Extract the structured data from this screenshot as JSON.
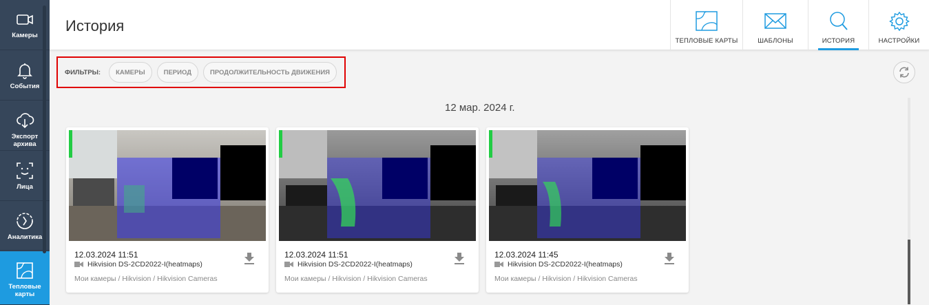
{
  "sidebar": {
    "items": [
      {
        "label": "Камеры",
        "icon": "camera-icon"
      },
      {
        "label": "События",
        "icon": "bell-icon"
      },
      {
        "label": "Экспорт\nархива",
        "icon": "cloud-download-icon"
      },
      {
        "label": "Лица",
        "icon": "face-icon"
      },
      {
        "label": "Аналитика",
        "icon": "analytics-icon"
      },
      {
        "label": "Тепловые\nкарты",
        "icon": "heatmap-icon"
      }
    ],
    "active_color": "#1e9be0",
    "background": "#36465a"
  },
  "header": {
    "title": "История",
    "tabs": [
      {
        "label": "ТЕПЛОВЫЕ КАРТЫ",
        "icon": "heatmap-icon"
      },
      {
        "label": "ШАБЛОНЫ",
        "icon": "envelope-icon"
      },
      {
        "label": "ИСТОРИЯ",
        "icon": "search-icon",
        "active": true
      },
      {
        "label": "НАСТРОЙКИ",
        "icon": "gear-icon"
      }
    ]
  },
  "filters": {
    "label": "ФИЛЬТРЫ:",
    "chips": [
      "КАМЕРЫ",
      "ПЕРИОД",
      "ПРОДОЛЖИТЕЛЬНОСТЬ ДВИЖЕНИЯ"
    ]
  },
  "refresh_icon": "refresh-icon",
  "date_label": "12 мар. 2024 г.",
  "cards": [
    {
      "timestamp": "12.03.2024 11:51",
      "camera": "Hikvision DS-2CD2022-I(heatmaps)",
      "path": "Мои камеры / Hikvision / Hikvision Cameras",
      "mode": "color"
    },
    {
      "timestamp": "12.03.2024 11:51",
      "camera": "Hikvision DS-2CD2022-I(heatmaps)",
      "path": "Мои камеры / Hikvision / Hikvision Cameras",
      "mode": "gray"
    },
    {
      "timestamp": "12.03.2024 11:45",
      "camera": "Hikvision DS-2CD2022-I(heatmaps)",
      "path": "Мои камеры / Hikvision / Hikvision Cameras",
      "mode": "gray"
    }
  ]
}
